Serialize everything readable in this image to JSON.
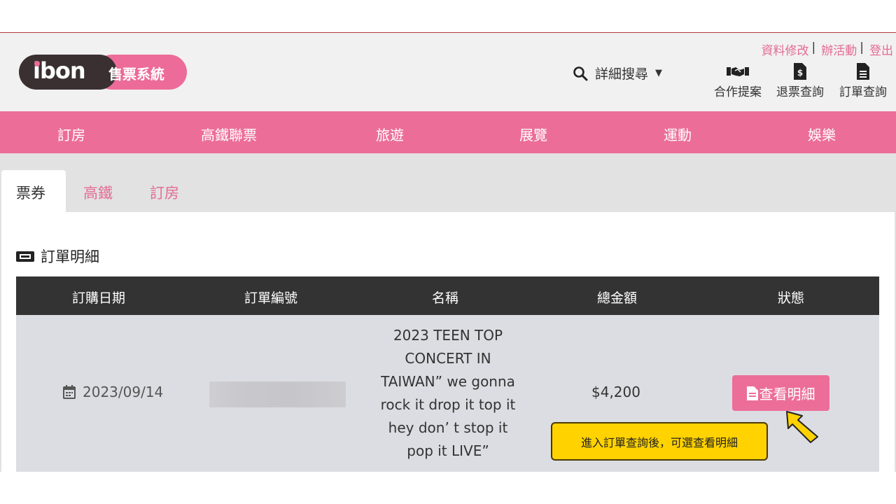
{
  "logo": {
    "brand": "ibon",
    "label": "售票系統"
  },
  "header": {
    "links": [
      "資料修改",
      "辦活動",
      "登出"
    ],
    "search_label": "詳細搜尋",
    "quick_links": [
      {
        "label": "合作提案",
        "icon": "handshake-icon"
      },
      {
        "label": "退票查詢",
        "icon": "refund-doc-icon"
      },
      {
        "label": "訂單查詢",
        "icon": "document-icon"
      }
    ]
  },
  "nav": {
    "items": [
      "訂房",
      "高鐵聯票",
      "旅遊",
      "展覽",
      "運動",
      "娛樂"
    ]
  },
  "tabs": {
    "items": [
      "票券",
      "高鐵",
      "訂房"
    ],
    "active": "票券"
  },
  "section": {
    "title": "訂單明細"
  },
  "table": {
    "headers": [
      "訂購日期",
      "訂單編號",
      "名稱",
      "總金額",
      "狀態"
    ],
    "rows": [
      {
        "date": "2023/09/14",
        "order_no": "",
        "name_lines": [
          "2023 TEEN TOP",
          "CONCERT IN",
          "TAIWAN” we gonna",
          "rock it drop it top it",
          "hey don’ t stop it",
          "pop it LIVE”"
        ],
        "amount": "$4,200",
        "action": "查看明細"
      }
    ]
  },
  "callout": {
    "text": "進入訂單查詢後，可選查看明細"
  },
  "colors": {
    "pink": "#ec6e98",
    "dark": "#333333",
    "callout": "#ffd200"
  }
}
